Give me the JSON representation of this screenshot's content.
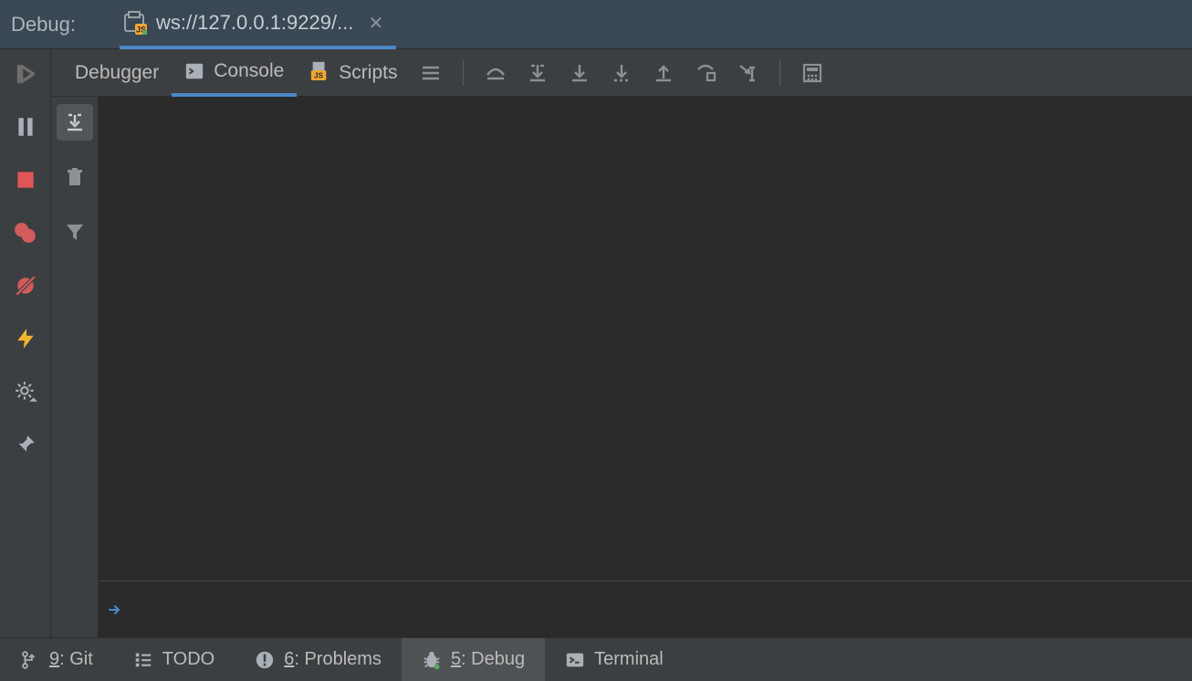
{
  "header": {
    "label": "Debug:",
    "session_title": "ws://127.0.0.1:9229/..."
  },
  "tabs": {
    "debugger": "Debugger",
    "console": "Console",
    "scripts": "Scripts"
  },
  "bottom": {
    "git_prefix": "9",
    "git_label": ": Git",
    "todo": "TODO",
    "problems_prefix": "6",
    "problems_label": ": Problems",
    "debug_prefix": "5",
    "debug_label": ": Debug",
    "terminal": "Terminal"
  }
}
